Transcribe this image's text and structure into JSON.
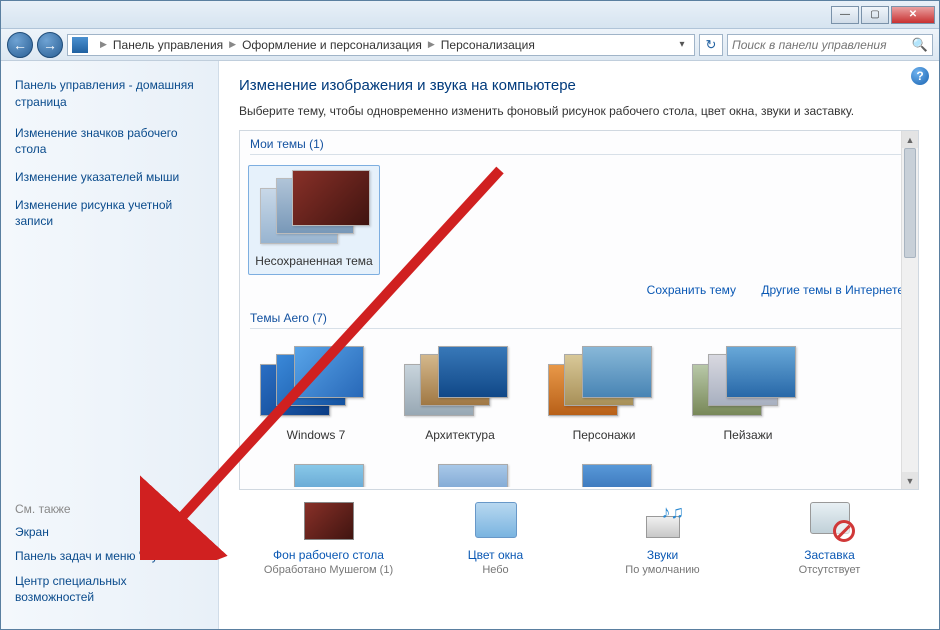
{
  "titlebar": {
    "min": "—",
    "max": "▢",
    "close": "✕"
  },
  "nav": {
    "back": "←",
    "forward": "→"
  },
  "breadcrumb": {
    "items": [
      "Панель управления",
      "Оформление и персонализация",
      "Персонализация"
    ]
  },
  "search": {
    "placeholder": "Поиск в панели управления"
  },
  "sidebar": {
    "home": "Панель управления - домашняя страница",
    "links": [
      "Изменение значков рабочего стола",
      "Изменение указателей мыши",
      "Изменение рисунка учетной записи"
    ],
    "see_also_h": "См. также",
    "see_also": [
      "Экран",
      "Панель задач и меню \"Пуск\"",
      "Центр специальных возможностей"
    ]
  },
  "main": {
    "heading": "Изменение изображения и звука на компьютере",
    "desc": "Выберите тему, чтобы одновременно изменить фоновый рисунок рабочего стола, цвет окна, звуки и заставку.",
    "my_themes_h": "Мои темы (1)",
    "my_themes": [
      {
        "name": "Несохраненная тема"
      }
    ],
    "actions": {
      "save": "Сохранить тему",
      "more": "Другие темы в Интернете"
    },
    "aero_h": "Темы Aero (7)",
    "aero": [
      {
        "name": "Windows 7",
        "cls": "win7"
      },
      {
        "name": "Архитектура",
        "cls": "arch"
      },
      {
        "name": "Персонажи",
        "cls": "pers"
      },
      {
        "name": "Пейзажи",
        "cls": "land"
      }
    ],
    "bottom": [
      {
        "title": "Фон рабочего стола",
        "sub": "Обработано Мушегом (1)"
      },
      {
        "title": "Цвет окна",
        "sub": "Небо"
      },
      {
        "title": "Звуки",
        "sub": "По умолчанию"
      },
      {
        "title": "Заставка",
        "sub": "Отсутствует"
      }
    ]
  }
}
